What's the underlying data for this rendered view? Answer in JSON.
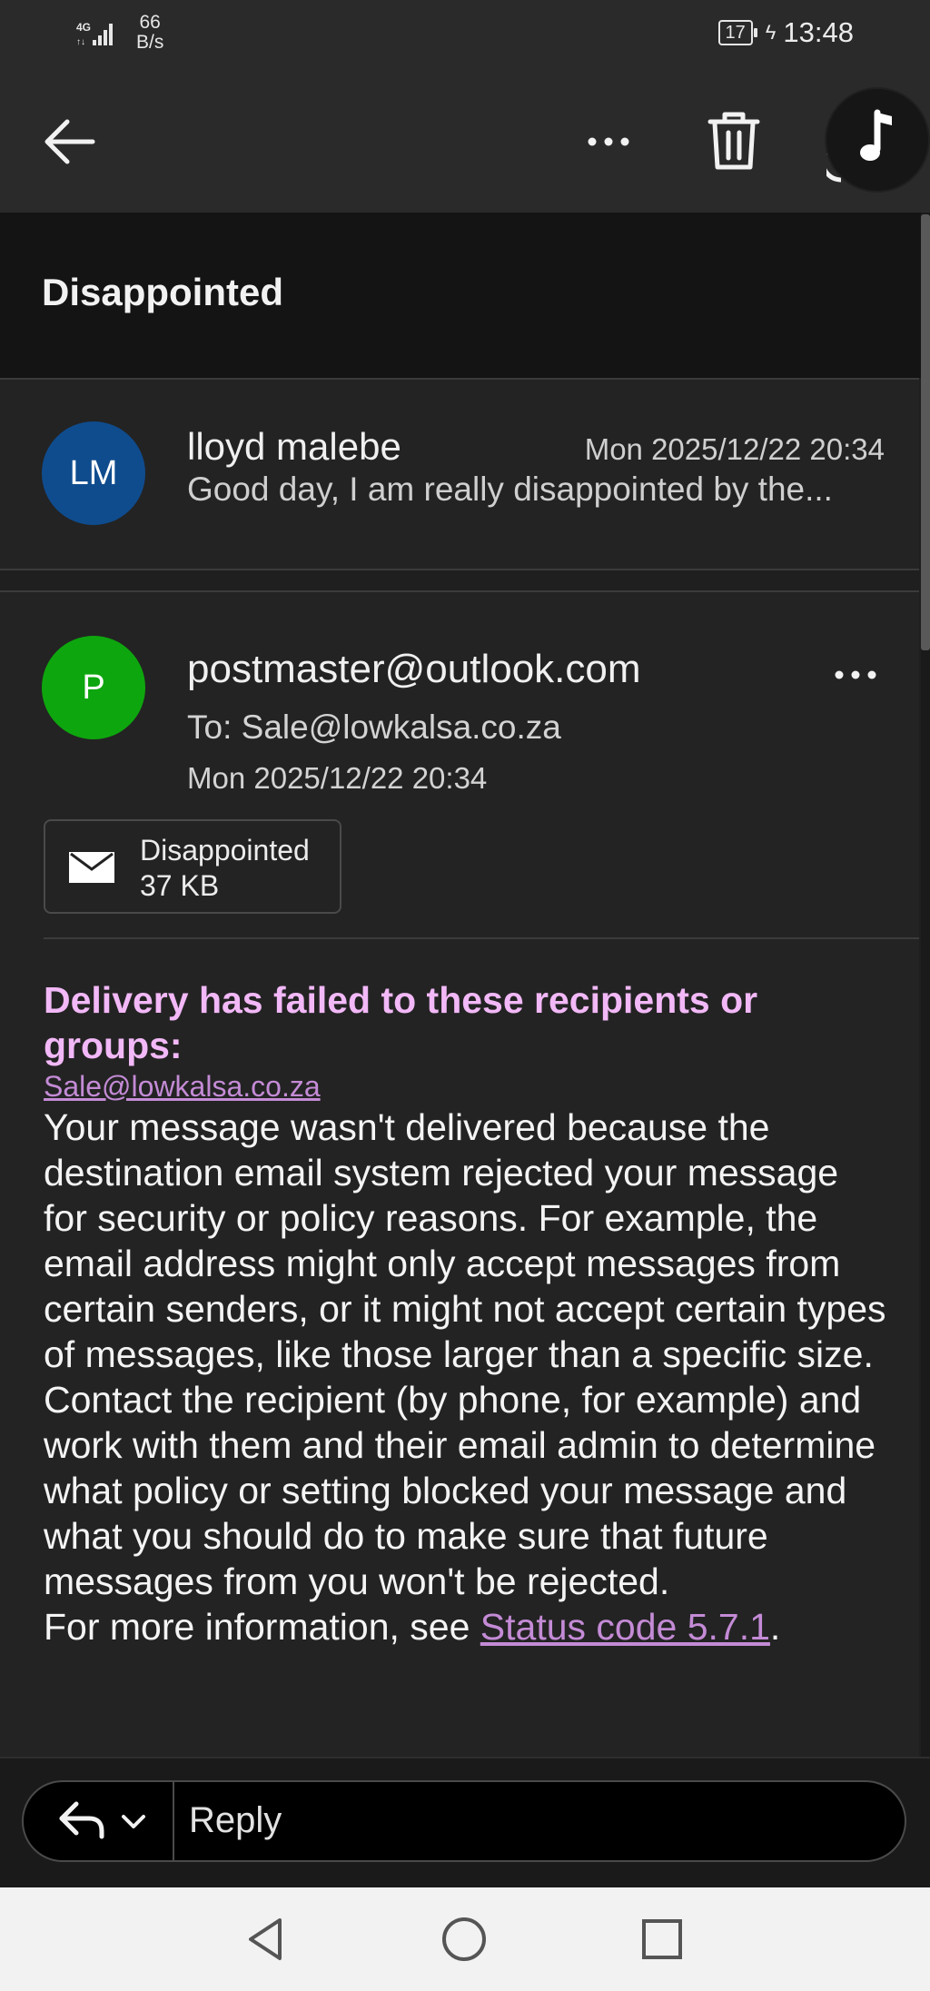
{
  "status_bar": {
    "network": "4G",
    "speed_value": "66",
    "speed_unit": "B/s",
    "battery": "17",
    "time": "13:48"
  },
  "app_bar": {
    "icons": [
      "back-arrow-icon",
      "more-horizontal-icon",
      "trash-icon",
      "music-note-icon"
    ]
  },
  "subject": "Disappointed",
  "message_collapsed": {
    "avatar_initials": "LM",
    "avatar_color": "#0f4c8e",
    "sender": "lloyd malebe",
    "date": "Mon 2025/12/22 20:34",
    "preview": "Good day, I am really disappointed by the..."
  },
  "message_expanded": {
    "avatar_initial": "P",
    "avatar_color": "#0ea60e",
    "sender": "postmaster@outlook.com",
    "to": "To: Sale@lowkalsa.co.za",
    "date": "Mon 2025/12/22 20:34",
    "attachment": {
      "name": "Disappointed",
      "size": "37 KB"
    },
    "body": {
      "heading": "Delivery has failed to these recipients or groups:",
      "recipient": "Sale@lowkalsa.co.za",
      "para1": "Your message wasn't delivered because the destination email system rejected your message for security or policy reasons. For example, the email address might only accept messages from certain senders, or it might not accept certain types of messages, like those larger than a specific size.",
      "para2": "Contact the recipient (by phone, for example) and work with them and their email admin to determine what policy or setting blocked your message and what you should do to make sure that future messages from you won't be rejected.",
      "para3_prefix": "For more information, see ",
      "status_link": "Status code 5.7.1",
      "para3_suffix": "."
    }
  },
  "reply_bar": {
    "placeholder": "Reply"
  },
  "colors": {
    "heading_pink": "#f2b8f7",
    "link_purple": "#c48bd6",
    "background": "#1f1f1f"
  }
}
